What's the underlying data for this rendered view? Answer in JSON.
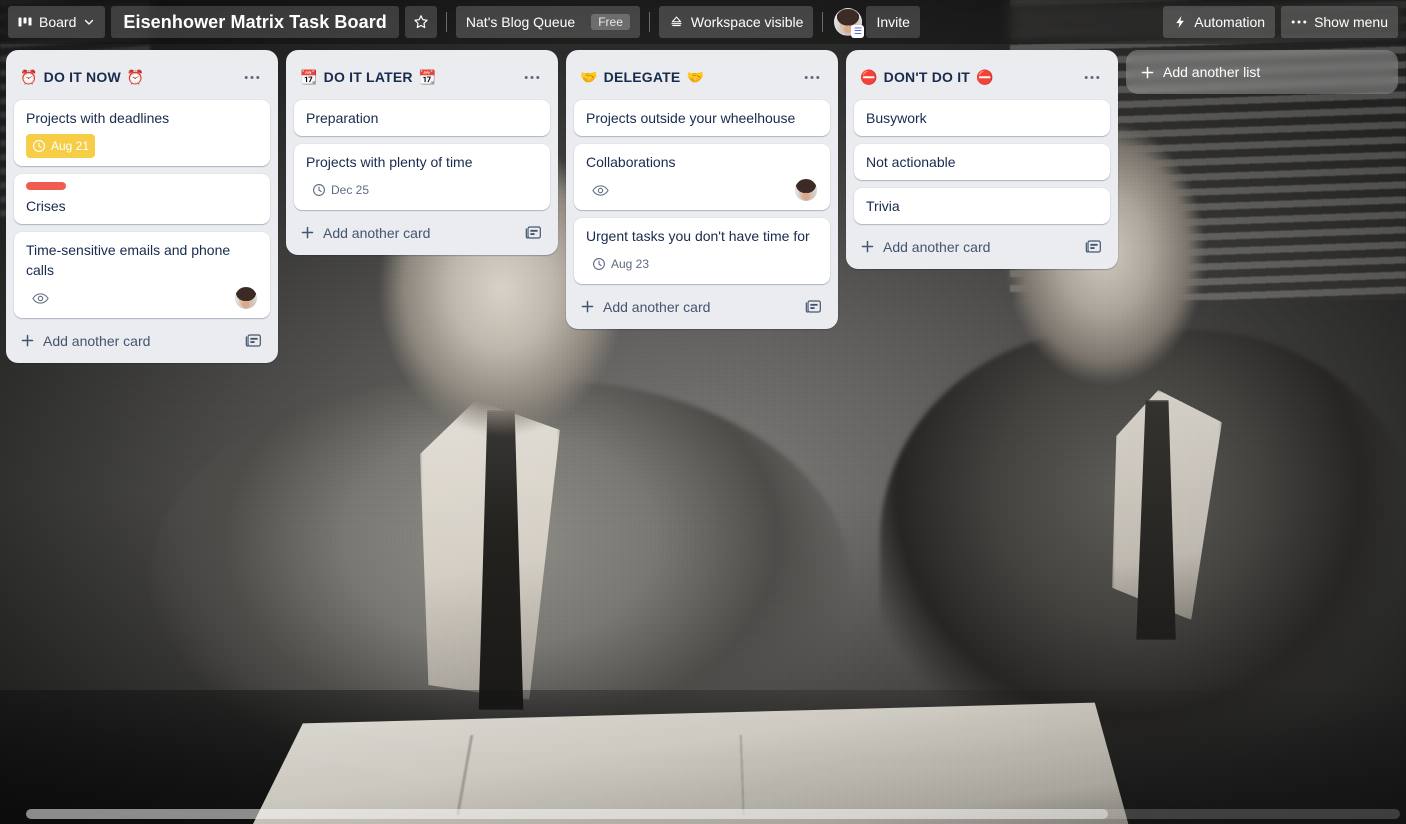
{
  "topbar": {
    "board_button": {
      "label": "Board",
      "icon": "board-icon",
      "chevron": "chevron-down-icon"
    },
    "board_title": "Eisenhower Matrix Task Board",
    "star_icon": "star-icon",
    "workspace_name": "Nat's Blog Queue",
    "plan_badge": "Free",
    "visibility": {
      "label": "Workspace visible",
      "icon": "workspace-visible-icon"
    },
    "avatar_badge": "☰",
    "invite_label": "Invite",
    "automation": {
      "label": "Automation",
      "icon": "lightning-icon"
    },
    "show_menu": {
      "label": "Show menu",
      "icon": "ellipsis-icon"
    }
  },
  "board": {
    "add_list_label": "Add another list",
    "add_list_icon": "plus-icon",
    "lists": [
      {
        "title": "DO IT NOW",
        "emoji_left": "⏰",
        "emoji_right": "⏰",
        "menu_icon": "ellipsis-icon",
        "add_card_label": "Add another card",
        "card_template_icon": "card-template-icon",
        "cards": [
          {
            "title": "Projects with deadlines",
            "labels": [],
            "due": {
              "text": "Aug 21",
              "style": "due-soon",
              "icon": "clock-icon"
            },
            "watching": false,
            "members": 0
          },
          {
            "title": "Crises",
            "labels": [
              {
                "color": "#f15b50",
                "name": "red-label"
              }
            ],
            "due": null,
            "watching": false,
            "members": 0
          },
          {
            "title": "Time-sensitive emails and phone calls",
            "labels": [],
            "due": null,
            "watching": true,
            "members": 1
          }
        ]
      },
      {
        "title": "DO IT LATER",
        "emoji_left": "📆",
        "emoji_right": "📆",
        "menu_icon": "ellipsis-icon",
        "add_card_label": "Add another card",
        "card_template_icon": "card-template-icon",
        "cards": [
          {
            "title": "Preparation",
            "labels": [],
            "due": null,
            "watching": false,
            "members": 0
          },
          {
            "title": "Projects with plenty of time",
            "labels": [],
            "due": {
              "text": "Dec 25",
              "style": "plain",
              "icon": "clock-icon"
            },
            "watching": false,
            "members": 0
          }
        ]
      },
      {
        "title": "DELEGATE",
        "emoji_left": "🤝",
        "emoji_right": "🤝",
        "menu_icon": "ellipsis-icon",
        "add_card_label": "Add another card",
        "card_template_icon": "card-template-icon",
        "cards": [
          {
            "title": "Projects outside your wheelhouse",
            "labels": [],
            "due": null,
            "watching": false,
            "members": 0
          },
          {
            "title": "Collaborations",
            "labels": [],
            "due": null,
            "watching": true,
            "members": 1
          },
          {
            "title": "Urgent tasks you don't have time for",
            "labels": [],
            "due": {
              "text": "Aug 23",
              "style": "plain",
              "icon": "clock-icon"
            },
            "watching": false,
            "members": 0
          }
        ]
      },
      {
        "title": "DON'T DO IT",
        "emoji_left": "⛔",
        "emoji_right": "⛔",
        "menu_icon": "ellipsis-icon",
        "add_card_label": "Add another card",
        "card_template_icon": "card-template-icon",
        "cards": [
          {
            "title": "Busywork",
            "labels": [],
            "due": null,
            "watching": false,
            "members": 0
          },
          {
            "title": "Not actionable",
            "labels": [],
            "due": null,
            "watching": false,
            "members": 0
          },
          {
            "title": "Trivia",
            "labels": [],
            "due": null,
            "watching": false,
            "members": 0
          }
        ]
      }
    ]
  },
  "colors": {
    "list_background": "#eaecf0",
    "card_background": "#ffffff",
    "text_primary": "#172b4d",
    "text_secondary": "#44546f",
    "due_soon_yellow": "#f5cd47",
    "red_label": "#f15b50"
  }
}
